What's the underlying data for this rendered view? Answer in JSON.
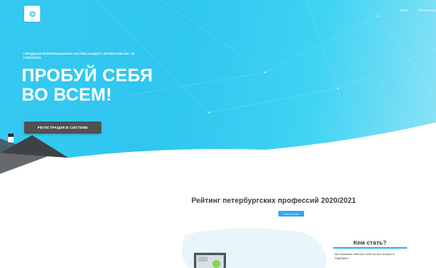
{
  "header": {
    "login_label": "Войти",
    "register_label": "Регистрация"
  },
  "hero": {
    "caption": "Городская информационная система каждого профессий шаг за горизонта",
    "title_line1": "ПРОБУЙ СЕБЯ",
    "title_line2": "ВО ВСЕМ!",
    "register_button": "РЕГИСТРАЦИЯ В СИСТЕМЕ"
  },
  "rating": {
    "title": "Рейтинг петербургских профессий 2020/2021",
    "button_label": "Узнать больше"
  },
  "become": {
    "title": "Кем стать?",
    "text": "Мы поможем ответить тебе на этот вопрос и подобрать"
  },
  "colors": {
    "hero_gradient_start": "#35c9f2",
    "hero_gradient_end": "#8de3f6",
    "hero_button": "#4f5152",
    "accent_blue": "#2fa8f0",
    "underline_blue": "#31b9f3",
    "text_dark": "#3a3a3a"
  },
  "icons": {
    "logo": "logo-icon"
  }
}
